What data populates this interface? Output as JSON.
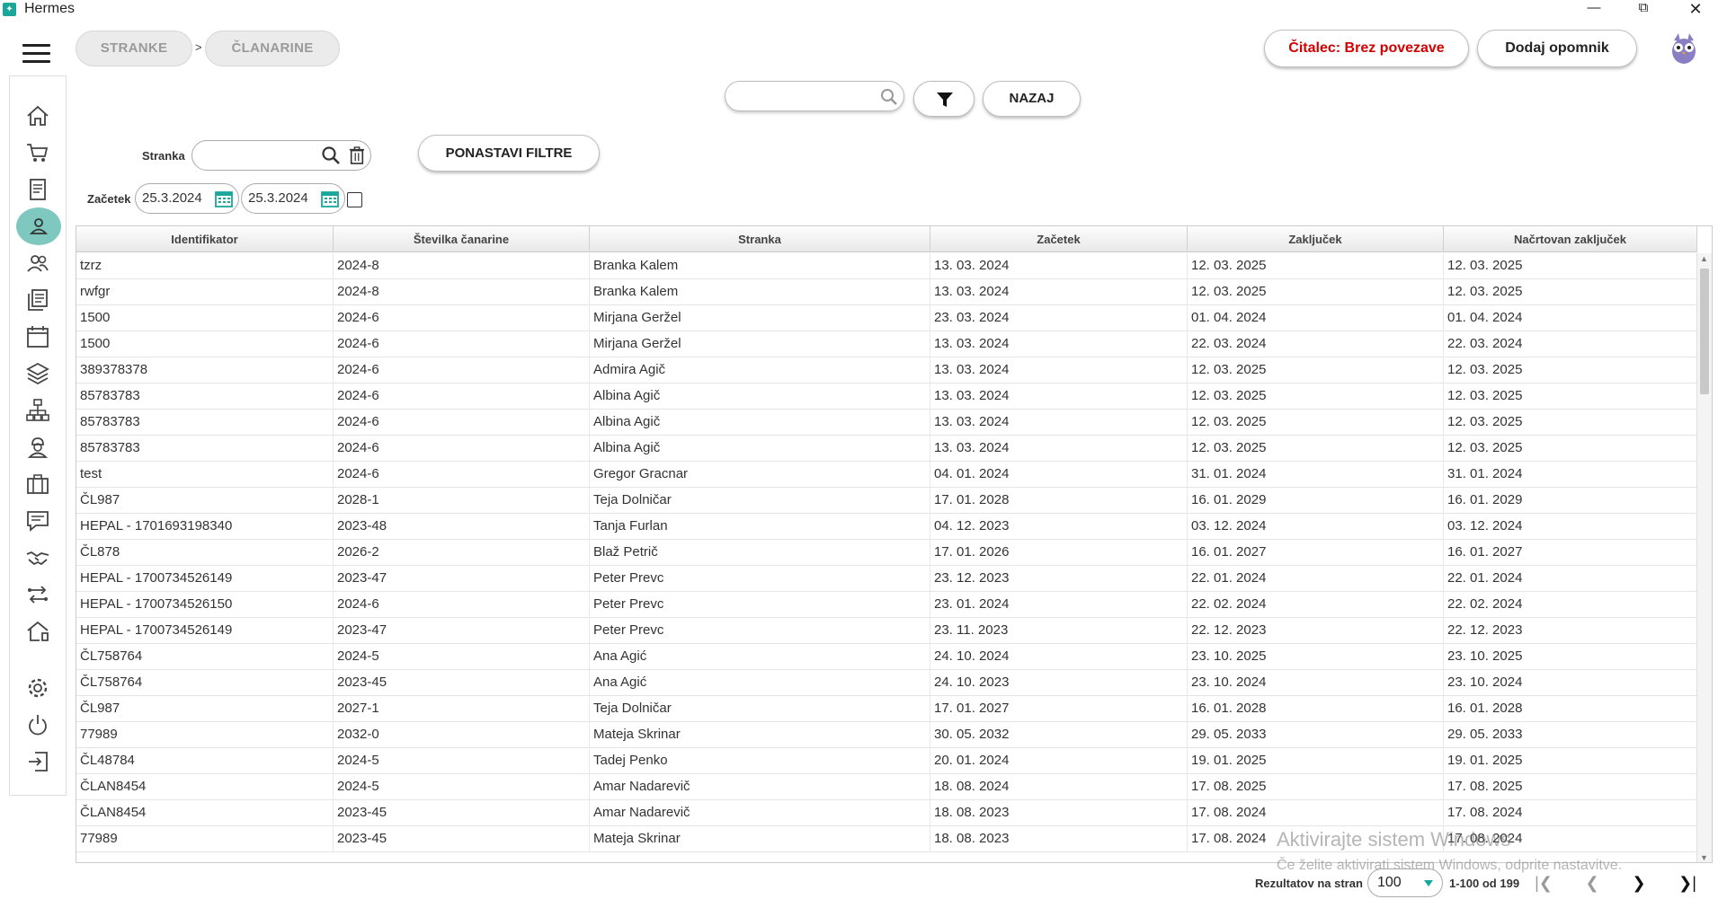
{
  "window": {
    "title": "Hermes",
    "minimize": "—",
    "maximize": "⧉",
    "close": "✕"
  },
  "breadcrumb": {
    "items": [
      "STRANKE",
      "ČLANARINE"
    ],
    "separator": ">"
  },
  "header": {
    "reader_label": "Čitalec: Brez povezave",
    "reminder_label": "Dodaj opomnik"
  },
  "toolbar": {
    "back_label": "NAZAJ",
    "search_value": ""
  },
  "filters": {
    "stranka_label": "Stranka",
    "stranka_value": "",
    "reset_label": "PONASTAVI FILTRE",
    "zacetek_label": "Začetek",
    "date_from": "25.3.2024",
    "date_to": "25.3.2024"
  },
  "colors": {
    "accent": "#1aa79a",
    "danger": "#d40000",
    "active_nav": "#7fc8c0"
  },
  "sidebar": {
    "items": [
      "home-icon",
      "cart-icon",
      "document-icon",
      "user-icon",
      "users-icon",
      "documents-icon",
      "calendar-icon",
      "layers-icon",
      "network-icon",
      "worker-icon",
      "briefcase-icon",
      "chat-icon",
      "handshake-icon",
      "transfer-icon",
      "house-icon",
      "gear-icon",
      "power-icon",
      "logout-icon"
    ],
    "active": "user-icon"
  },
  "table": {
    "columns": [
      "Identifikator",
      "Številka čanarine",
      "Stranka",
      "Začetek",
      "Zaključek",
      "Načrtovan zaključek"
    ],
    "rows": [
      [
        "tzrz",
        "2024-8",
        "Branka Kalem",
        "13. 03. 2024",
        "12. 03. 2025",
        "12. 03. 2025"
      ],
      [
        "rwfgr",
        "2024-8",
        "Branka Kalem",
        "13. 03. 2024",
        "12. 03. 2025",
        "12. 03. 2025"
      ],
      [
        "1500",
        "2024-6",
        "Mirjana Geržel",
        "23. 03. 2024",
        "01. 04. 2024",
        "01. 04. 2024"
      ],
      [
        "1500",
        "2024-6",
        "Mirjana Geržel",
        "13. 03. 2024",
        "22. 03. 2024",
        "22. 03. 2024"
      ],
      [
        "389378378",
        "2024-6",
        "Admira Agič",
        "13. 03. 2024",
        "12. 03. 2025",
        "12. 03. 2025"
      ],
      [
        "85783783",
        "2024-6",
        "Albina Agič",
        "13. 03. 2024",
        "12. 03. 2025",
        "12. 03. 2025"
      ],
      [
        "85783783",
        "2024-6",
        "Albina Agič",
        "13. 03. 2024",
        "12. 03. 2025",
        "12. 03. 2025"
      ],
      [
        "85783783",
        "2024-6",
        "Albina Agič",
        "13. 03. 2024",
        "12. 03. 2025",
        "12. 03. 2025"
      ],
      [
        "test",
        "2024-6",
        "Gregor Gracnar",
        "04. 01. 2024",
        "31. 01. 2024",
        "31. 01. 2024"
      ],
      [
        "ČL987",
        "2028-1",
        "Teja Dolničar",
        "17. 01. 2028",
        "16. 01. 2029",
        "16. 01. 2029"
      ],
      [
        "HEPAL - 1701693198340",
        "2023-48",
        "Tanja Furlan",
        "04. 12. 2023",
        "03. 12. 2024",
        "03. 12. 2024"
      ],
      [
        "ČL878",
        "2026-2",
        "Blaž Petrič",
        "17. 01. 2026",
        "16. 01. 2027",
        "16. 01. 2027"
      ],
      [
        "HEPAL - 1700734526149",
        "2023-47",
        "Peter Prevc",
        "23. 12. 2023",
        "22. 01. 2024",
        "22. 01. 2024"
      ],
      [
        "HEPAL - 1700734526150",
        "2024-6",
        "Peter Prevc",
        "23. 01. 2024",
        "22. 02. 2024",
        "22. 02. 2024"
      ],
      [
        "HEPAL - 1700734526149",
        "2023-47",
        "Peter Prevc",
        "23. 11. 2023",
        "22. 12. 2023",
        "22. 12. 2023"
      ],
      [
        "ČL758764",
        "2024-5",
        "Ana Agić",
        "24. 10. 2024",
        "23. 10. 2025",
        "23. 10. 2025"
      ],
      [
        "ČL758764",
        "2023-45",
        "Ana Agić",
        "24. 10. 2023",
        "23. 10. 2024",
        "23. 10. 2024"
      ],
      [
        "ČL987",
        "2027-1",
        "Teja Dolničar",
        "17. 01. 2027",
        "16. 01. 2028",
        "16. 01. 2028"
      ],
      [
        "77989",
        "2032-0",
        "Mateja Skrinar",
        "30. 05. 2032",
        "29. 05. 2033",
        "29. 05. 2033"
      ],
      [
        "ČL48784",
        "2024-5",
        "Tadej Penko",
        "20. 01. 2024",
        "19. 01. 2025",
        "19. 01. 2025"
      ],
      [
        "ČLAN8454",
        "2024-5",
        "Amar Nadarevič",
        "18. 08. 2024",
        "17. 08. 2025",
        "17. 08. 2025"
      ],
      [
        "ČLAN8454",
        "2023-45",
        "Amar Nadarevič",
        "18. 08. 2023",
        "17. 08. 2024",
        "17. 08. 2024"
      ],
      [
        "77989",
        "2023-45",
        "Mateja Skrinar",
        "18. 08. 2023",
        "17. 08. 2024",
        "17. 08. 2024"
      ]
    ]
  },
  "watermark": {
    "line1": "Aktivirajte sistem Windows",
    "line2": "Če želite aktivirati sistem Windows, odprite nastavitve."
  },
  "pagination": {
    "per_page_label": "Rezultatov na stran",
    "per_page": "100",
    "range": "1-100 od 199"
  }
}
